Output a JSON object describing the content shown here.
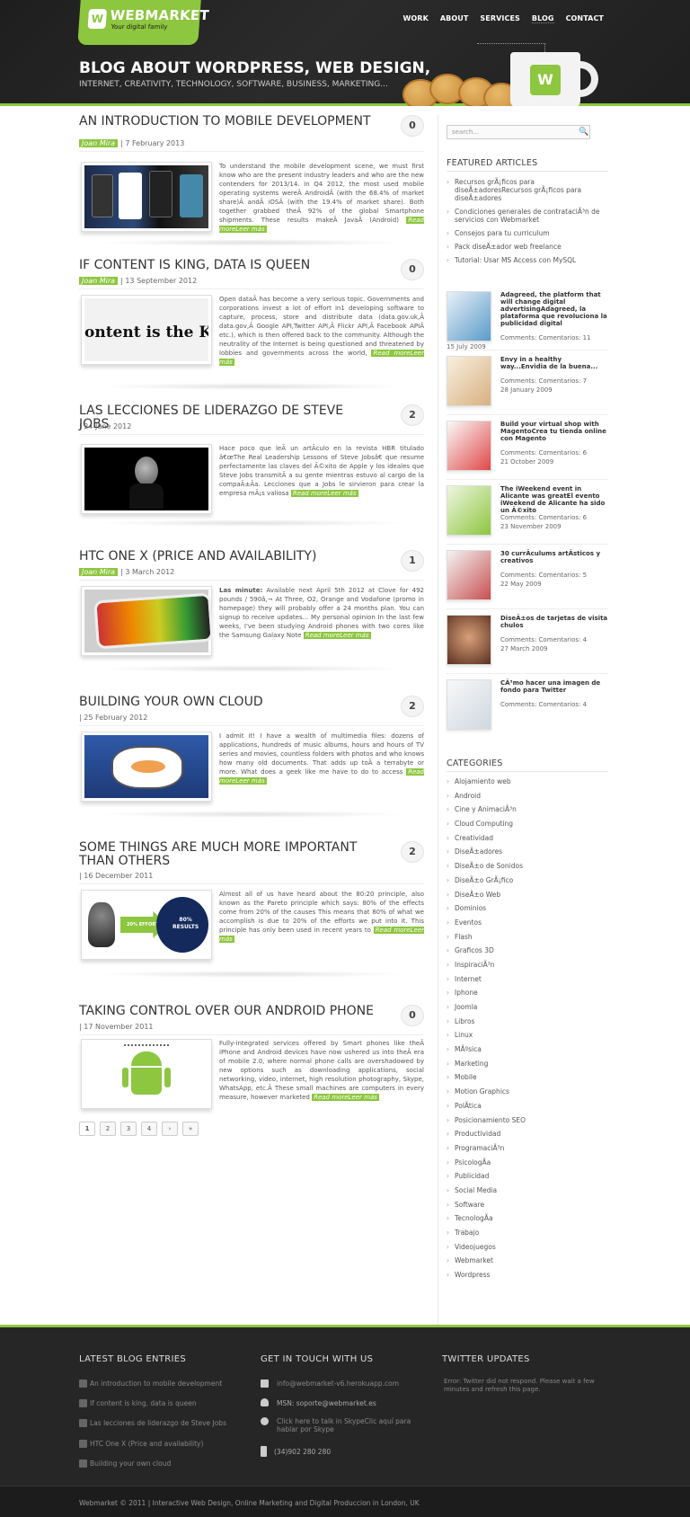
{
  "header": {
    "logo_mark": "W",
    "logo_name": "WEBMARKET",
    "logo_tag": "Your digital family",
    "nav": [
      "WORK",
      "ABOUT",
      "SERVICES",
      "BLOG",
      "CONTACT"
    ],
    "hero_title": "BLOG ABOUT WORDPRESS, WEB DESIGN,",
    "hero_sub": "INTERNET, CREATIVITY, TECHNOLOGY, SOFTWARE, BUSINESS, MARKETING...",
    "mug_logo": "W"
  },
  "posts": [
    {
      "title": "AN INTRODUCTION TO MOBILE DEVELOPMENT",
      "author": "Joan Mira",
      "date": "7 February 2013",
      "comments": "0",
      "excerpt": "To understand the mobile development scene, we must first know who are the present industry leaders and who are the new contenders for 2013/14. In Q4 2012, the most used mobile operating systems wereÂ AndroidÂ (with the 68.4% of market share)Â andÂ iOSÂ (with the 19.4% of market share). Both together grabbed theÂ 92% of the global Smartphone shipments. These results makeÂ JavaÂ (Android) ",
      "readmore": "Read moreLeer más"
    },
    {
      "title": "IF CONTENT IS KING, DATA IS QUEEN",
      "author": "Joan Mira",
      "date": "13 September 2012",
      "comments": "0",
      "excerpt": "Open dataÂ has become a very serious topic. Governments and corporations invest a lot of effort in1 developing software to capture, process, store and distribute data (data.gov.uk,Â data.gov,Â Google API,Twitter API,Â Flickr API,Â Facebook APIÂ etc.), which is then offered back to the community. Although the neutrality of the Internet is being questioned and threatened by lobbies and governments across the world, ",
      "readmore": "Read moreLeer más"
    },
    {
      "title": "LAS LECCIONES DE LIDERAZGO DE STEVE JOBS",
      "author": "",
      "date": "24 June 2012",
      "comments": "2",
      "excerpt": "Hace poco que leÃ un artÃculo en la revista HBR titulado â€œThe Real Leadership Lessons of Steve Jobsâ€ que resume perfectamente las claves del Ã©xito de Apple y los ideales que Steve Jobs transmitÃ a su gente mientras estuvo al cargo de la compaÃ±Ã­a. Lecciones que a Jobs le sirvieron para crear la empresa mÃ¡s valiosa ",
      "readmore": "Read moreLeer más"
    },
    {
      "title": "HTC ONE X (PRICE AND AVAILABILITY)",
      "author": "Joan Mira",
      "date": "3 March 2012",
      "comments": "1",
      "excerpt_lead": "Las minute:",
      "excerpt": " Available next April 5th 2012 at Clove for 492 pounds / 590â‚¬ At Three, O2, Orange and Vodafone (promo in homepage) they will probably offer a 24 months plan. You can signup to receive updates... My personal opinion In the last few weeks, I've been studying Android phones with two cores like the Samsung Galaxy Note ",
      "readmore": "Read moreLeer más"
    },
    {
      "title": "BUILDING YOUR OWN CLOUD",
      "author": "",
      "date": "25 February 2012",
      "comments": "2",
      "excerpt": "I admit it! I have a wealth of multimedia files: dozens of applications, hundreds of music albums, hours and hours of TV series and movies, countless folders with photos and who knows how many old documents. That adds up toÂ a terrabyte or more. What does a geek like me have to do to access ",
      "readmore": "Read moreLeer más"
    },
    {
      "title": "SOME THINGS ARE MUCH MORE IMPORTANT THAN OTHERS",
      "author": "",
      "date": "16 December 2011",
      "comments": "2",
      "excerpt": "Almost all of us have heard about the 80:20 principle, also known as the Pareto principle which says: 80% of the effects come from 20% of the causes This means that 80% of what we accomplish is due to 20% of the efforts we put into it. This principle has only been used in recent years to ",
      "readmore": "Read moreLeer más",
      "img_left": "20% EFFORT",
      "img_right_1": "80%",
      "img_right_2": "RESULTS"
    },
    {
      "title": "TAKING CONTROL OVER OUR ANDROID PHONE",
      "author": "",
      "date": "17 November 2011",
      "comments": "0",
      "excerpt": "Fully-integrated services offered by Smart phones like theÂ iPhone and Android devices have now ushered us into theÂ era of mobile 2.0, where normal phone calls are overshadowed by new options such as downloading applications, social networking, video, internet, high resolution photography, Skype, WhatsApp, etc.Â These small machines are computers in every measure, however marketed ",
      "readmore": "Read moreLeer más"
    }
  ],
  "thumb_text": {
    "content_king": "ontent is the Ki"
  },
  "pager": [
    "1",
    "2",
    "3",
    "4",
    "›",
    "»"
  ],
  "sidebar": {
    "search_placeholder": "search...",
    "featured_title": "FEATURED ARTICLES",
    "featured": [
      "Recursos grÃ¡ficos para diseÃ±adoresRecursos grÃ¡ficos para diseÃ±adores",
      "Condiciones generales de contrataciÃ³n de servicios con Webmarket",
      "Consejos para tu curriculum",
      "Pack diseÃ±ador web freelance",
      "Tutorial: Usar MS Access con MySQL"
    ],
    "recent": [
      {
        "title": "Adagreed, the platform that will change digital advertisingAdagreed, la plataforma que revoluciona la publicidad digital",
        "comments": "Comments: Comentarios: 11",
        "date": "15 July 2009"
      },
      {
        "title": "Envy in a healthy way...Envidia de la buena...",
        "comments": "Comments: Comentarios: 7",
        "date": "28 January 2009"
      },
      {
        "title": "Build your virtual shop with MagentoCrea tu tienda online con Magento",
        "comments": "Comments: Comentarios: 6",
        "date": "21 October 2009"
      },
      {
        "title": "The iWeekend event in Alicante was greatEl evento iWeekend de Alicante ha sido un Ã©xito",
        "comments": "Comments: Comentarios: 6",
        "date": "23 November 2009"
      },
      {
        "title": "30 currÃculums artÃsticos y creativos",
        "comments": "Comments: Comentarios: 5",
        "date": "22 May 2009"
      },
      {
        "title": "DiseÃ±os de tarjetas de visita chulos",
        "comments": "Comments: Comentarios: 4",
        "date": "27 March 2009"
      },
      {
        "title": "CÃ³mo hacer una imagen de fondo para Twitter",
        "comments": "Comments: Comentarios: 4",
        "date": ""
      }
    ],
    "categories_title": "CATEGORIES",
    "categories": [
      "Alojamiento web",
      "Android",
      "Cine y AnimaciÃ³n",
      "Cloud Computing",
      "Creatividad",
      "DiseÃ±adores",
      "DiseÃ±o de Sonidos",
      "DiseÃ±o GrÃ¡fico",
      "DiseÃ±o Web",
      "Dominios",
      "Eventos",
      "Flash",
      "Graficos 3D",
      "InspiraciÃ³n",
      "Internet",
      "Iphone",
      "Joomla",
      "Libros",
      "Linux",
      "MÃºsica",
      "Marketing",
      "Mobile",
      "Motion Graphics",
      "PolÃtica",
      "Posicionamiento SEO",
      "Productividad",
      "ProgramaciÃ³n",
      "PsicologÃ­a",
      "Publicidad",
      "Social Media",
      "Software",
      "TecnologÃ­a",
      "Trabajo",
      "Videojuegos",
      "Webmarket",
      "Wordpress"
    ]
  },
  "footer": {
    "latest_title": "LATEST BLOG ENTRIES",
    "latest": [
      "An introduction to mobile development",
      "If content is king, data is queen",
      "Las lecciones de liderazgo de Steve Jobs",
      "HTC One X (Price and availability)",
      "Building your own cloud"
    ],
    "contact_title": "GET IN TOUCH WITH US",
    "email": "info@webmarket-v6.herokuapp.com",
    "msn": "MSN: soporte@webmarket.es",
    "skype": "Click here to talk in SkypeClic aquí para hablar por Skype",
    "phone": "(34)902 280 280",
    "twitter_title": "TWITTER UPDATES",
    "twitter_error": "Error: Twitter did not respond. Please wait a few minutes and refresh this page.",
    "copyright": "Webmarket © 2011 | Interactive Web Design, Online Marketing and Digital Produccion in London, UK"
  },
  "colors": {
    "accent": "#8dc63f",
    "dark": "#1b1b1b"
  }
}
